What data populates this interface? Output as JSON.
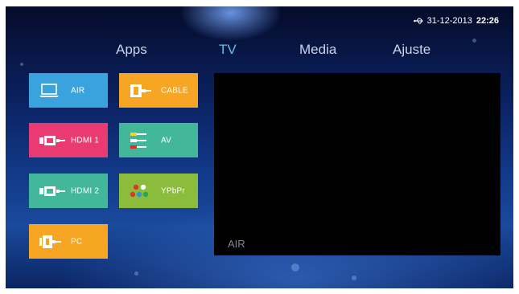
{
  "status": {
    "date": "31-12-2013",
    "time": "22:26",
    "icon": "usb-icon"
  },
  "nav": [
    {
      "label": "Apps",
      "active": false
    },
    {
      "label": "TV",
      "active": true
    },
    {
      "label": "Media",
      "active": false
    },
    {
      "label": "Ajuste",
      "active": false
    }
  ],
  "sources": [
    {
      "label": "AIR",
      "icon": "laptop-icon",
      "color": "#3aa3de"
    },
    {
      "label": "CABLE",
      "icon": "cable-icon",
      "color": "#f6a623"
    },
    {
      "label": "HDMI 1",
      "icon": "hdmi-icon",
      "color": "#e93a73"
    },
    {
      "label": "AV",
      "icon": "av-icon",
      "color": "#42b79a"
    },
    {
      "label": "HDMI 2",
      "icon": "hdmi-icon",
      "color": "#42b79a"
    },
    {
      "label": "YPbPr",
      "icon": "ypbpr-icon",
      "color": "#8cbc3c"
    },
    {
      "label": "PC",
      "icon": "pc-icon",
      "color": "#f6a623"
    }
  ],
  "preview": {
    "label": "AIR"
  }
}
